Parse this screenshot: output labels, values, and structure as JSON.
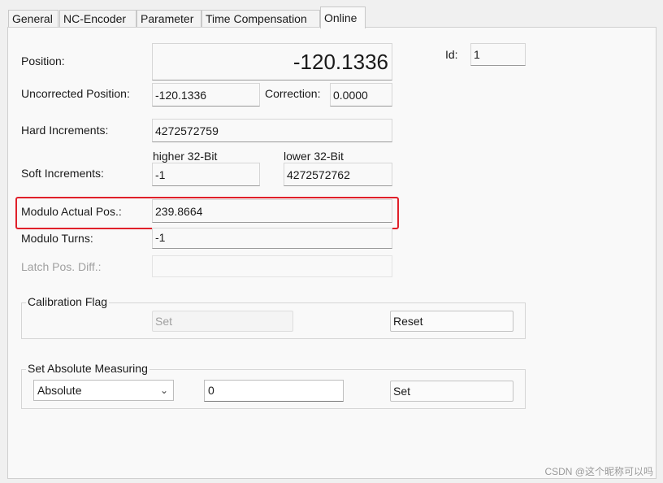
{
  "tabs": [
    "General",
    "NC-Encoder",
    "Parameter",
    "Time Compensation",
    "Online"
  ],
  "active_tab": "Online",
  "labels": {
    "position": "Position:",
    "uncorrected_position": "Uncorrected Position:",
    "correction": "Correction:",
    "hard_increments": "Hard Increments:",
    "higher_32": "higher 32-Bit",
    "lower_32": "lower 32-Bit",
    "soft_increments": "Soft Increments:",
    "modulo_actual_pos": "Modulo Actual Pos.:",
    "modulo_turns": "Modulo Turns:",
    "latch_pos_diff": "Latch Pos. Diff.:",
    "id": "Id:"
  },
  "values": {
    "position": "-120.1336",
    "uncorrected_position": "-120.1336",
    "correction": "0.0000",
    "hard_increments": "4272572759",
    "soft_increments_high": "-1",
    "soft_increments_low": "4272572762",
    "modulo_actual_pos": "239.8664",
    "modulo_turns": "-1",
    "latch_pos_diff": "",
    "id": "1"
  },
  "calibration_flag": {
    "title": "Calibration Flag",
    "set_label": "Set",
    "reset_label": "Reset"
  },
  "set_absolute_measuring": {
    "title": "Set Absolute Measuring",
    "mode_selected": "Absolute",
    "value": "0",
    "set_label": "Set"
  },
  "watermark": "CSDN @这个昵称可以吗",
  "highlight_color": "#e0202a"
}
